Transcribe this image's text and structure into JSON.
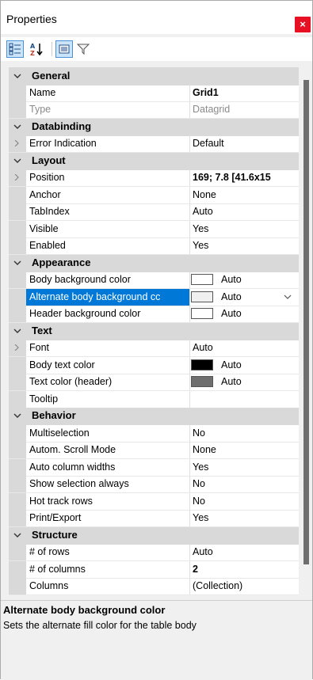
{
  "window": {
    "title": "Properties",
    "close_label": "×"
  },
  "toolbar": {
    "buttons": [
      {
        "name": "categorized-view-icon",
        "active": true
      },
      {
        "name": "alphabetical-sort-icon",
        "active": false
      },
      {
        "name": "property-pages-icon",
        "active": true
      },
      {
        "name": "filter-icon",
        "active": false
      }
    ]
  },
  "categories": {
    "general": "General",
    "databinding": "Databinding",
    "layout": "Layout",
    "appearance": "Appearance",
    "text": "Text",
    "behavior": "Behavior",
    "structure": "Structure"
  },
  "props": {
    "name": {
      "label": "Name",
      "value": "Grid1"
    },
    "type": {
      "label": "Type",
      "value": "Datagrid"
    },
    "error_indication": {
      "label": "Error Indication",
      "value": "Default"
    },
    "position": {
      "label": "Position",
      "value": "169; 7.8 [41.6x15"
    },
    "anchor": {
      "label": "Anchor",
      "value": "None"
    },
    "tabindex": {
      "label": "TabIndex",
      "value": "Auto"
    },
    "visible": {
      "label": "Visible",
      "value": "Yes"
    },
    "enabled": {
      "label": "Enabled",
      "value": "Yes"
    },
    "body_bg": {
      "label": "Body background color",
      "value": "Auto",
      "swatch": "#ffffff"
    },
    "alt_body_bg": {
      "label": "Alternate body background cc",
      "value": "Auto",
      "swatch": "#f0f0f0"
    },
    "header_bg": {
      "label": "Header background color",
      "value": "Auto",
      "swatch": "#ffffff"
    },
    "font": {
      "label": "Font",
      "value": "Auto"
    },
    "body_text_color": {
      "label": "Body text color",
      "value": "Auto",
      "swatch": "#000000"
    },
    "header_text_color": {
      "label": "Text color (header)",
      "value": "Auto",
      "swatch": "#6e6e6e"
    },
    "tooltip": {
      "label": "Tooltip",
      "value": ""
    },
    "multiselection": {
      "label": "Multiselection",
      "value": "No"
    },
    "autom_scroll": {
      "label": "Autom. Scroll Mode",
      "value": "None"
    },
    "auto_col_widths": {
      "label": "Auto column widths",
      "value": "Yes"
    },
    "show_selection": {
      "label": "Show selection always",
      "value": "No"
    },
    "hot_track": {
      "label": "Hot track rows",
      "value": "No"
    },
    "print_export": {
      "label": "Print/Export",
      "value": "Yes"
    },
    "num_rows": {
      "label": "# of rows",
      "value": "Auto"
    },
    "num_columns": {
      "label": "# of columns",
      "value": "2"
    },
    "columns": {
      "label": "Columns",
      "value": "(Collection)"
    }
  },
  "description": {
    "title": "Alternate body background color",
    "text": "Sets the alternate fill color for the table body"
  },
  "colors": {
    "accent": "#0078d7",
    "close": "#e81123",
    "category_bg": "#d9d9d9"
  }
}
